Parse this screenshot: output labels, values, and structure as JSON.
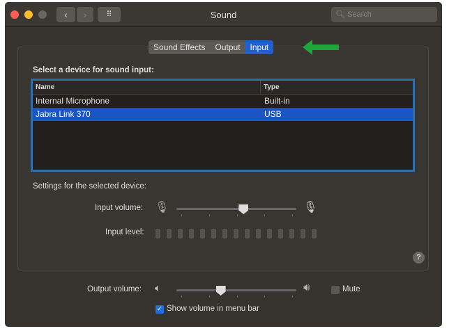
{
  "window": {
    "title": "Sound",
    "search_placeholder": "Search"
  },
  "tabs": [
    {
      "label": "Sound Effects",
      "selected": false
    },
    {
      "label": "Output",
      "selected": false
    },
    {
      "label": "Input",
      "selected": true
    }
  ],
  "input": {
    "device_heading": "Select a device for sound input:",
    "columns": [
      "Name",
      "Type"
    ],
    "devices": [
      {
        "name": "Internal Microphone",
        "type": "Built-in",
        "selected": false
      },
      {
        "name": "Jabra Link 370",
        "type": "USB",
        "selected": true
      }
    ],
    "settings_heading": "Settings for the selected device:",
    "input_volume_label": "Input volume:",
    "input_volume": 0.56,
    "input_level_label": "Input level:",
    "input_level": 0
  },
  "help_label": "?",
  "output_volume_label": "Output volume:",
  "output_volume": 0.37,
  "mute_label": "Mute",
  "mute_checked": false,
  "show_volume_label": "Show volume in menu bar",
  "show_volume_checked": true,
  "colors": {
    "accent": "#1f5fce",
    "arrow": "#1fa53a"
  }
}
